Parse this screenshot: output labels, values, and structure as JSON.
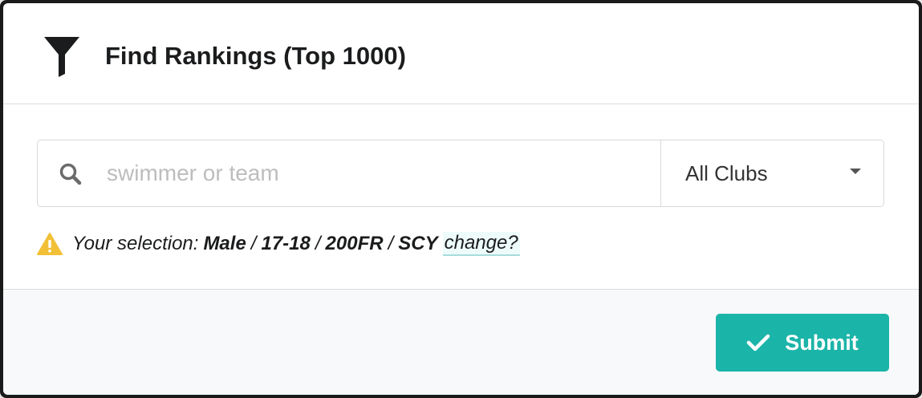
{
  "header": {
    "icon": "filter-funnel-icon",
    "title": "Find Rankings (Top 1000)"
  },
  "search": {
    "icon": "search-icon",
    "value": "",
    "placeholder": "swimmer or team"
  },
  "club_select": {
    "selected": "All Clubs",
    "icon": "caret-down-icon"
  },
  "selection": {
    "icon": "warning-icon",
    "prefix": "Your selection:",
    "parts": [
      "Male",
      "17-18",
      "200FR",
      "SCY"
    ],
    "separator": "/",
    "change_link": "change?"
  },
  "footer": {
    "submit_label": "Submit",
    "submit_icon": "checkmark-icon"
  },
  "colors": {
    "accent": "#1bb4a8",
    "warning": "#f2c037",
    "text": "#1b1c1d",
    "placeholder": "#bdbdbd"
  }
}
